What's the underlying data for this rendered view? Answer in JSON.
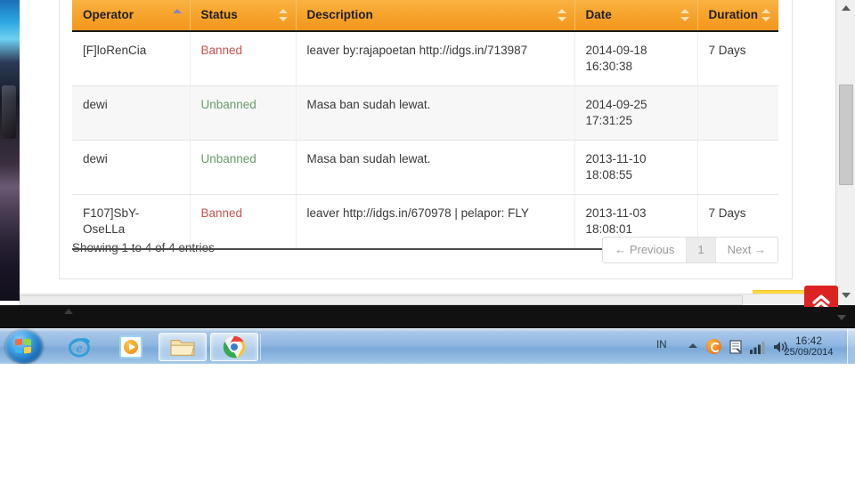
{
  "table": {
    "columns": [
      {
        "label": "Operator",
        "sort": "asc"
      },
      {
        "label": "Status",
        "sort": "none"
      },
      {
        "label": "Description",
        "sort": "none"
      },
      {
        "label": "Date",
        "sort": "none"
      },
      {
        "label": "Duration",
        "sort": "none"
      }
    ],
    "rows": [
      {
        "operator": "[F]loRenCia",
        "status": "Banned",
        "status_kind": "banned",
        "description": "leaver by:rajapoetan http://idgs.in/713987",
        "date_date": "2014-09-18",
        "date_time": "16:30:38",
        "duration": "7 Days"
      },
      {
        "operator": "dewi",
        "status": "Unbanned",
        "status_kind": "unbanned",
        "description": "Masa ban sudah lewat.",
        "date_date": "2014-09-25",
        "date_time": "17:31:25",
        "duration": ""
      },
      {
        "operator": "dewi",
        "status": "Unbanned",
        "status_kind": "unbanned",
        "description": "Masa ban sudah lewat.",
        "date_date": "2013-11-10",
        "date_time": "18:08:55",
        "duration": ""
      },
      {
        "operator": "F107]SbY-OseLLa",
        "status": "Banned",
        "status_kind": "banned",
        "description": "leaver http://idgs.in/670978 | pelapor: FLY",
        "date_date": "2013-11-03",
        "date_time": "18:08:01",
        "duration": "7 Days"
      }
    ],
    "info": "Showing 1 to 4 of 4 entries",
    "pagination": {
      "previous": "← Previous",
      "page_current": "1",
      "next": "Next →"
    }
  },
  "widgets": {
    "scroll_top_icon": "double-chevron-up-icon"
  },
  "taskbar": {
    "start_label": "Start",
    "buttons": [
      {
        "name": "internet-explorer",
        "icon": "internet-explorer-icon"
      },
      {
        "name": "windows-media-player",
        "icon": "media-player-icon"
      },
      {
        "name": "windows-explorer",
        "icon": "folder-icon"
      },
      {
        "name": "google-chrome",
        "icon": "chrome-icon"
      }
    ],
    "tray": {
      "language": "IN",
      "expand_icon": "chevron-up-icon",
      "icons": [
        "antivirus-icon",
        "action-center-icon",
        "network-signal-icon",
        "volume-icon"
      ]
    },
    "clock": {
      "time": "16:42",
      "date": "25/09/2014"
    }
  },
  "colors": {
    "header_orange": "#f6a22a",
    "banned_red": "#c9524f",
    "unbanned_green": "#6a9a6a",
    "scroll_top_red": "#dd2222",
    "sort_active_purple": "#8a7fd0",
    "ribbon_yellow": "#ffd83b"
  }
}
